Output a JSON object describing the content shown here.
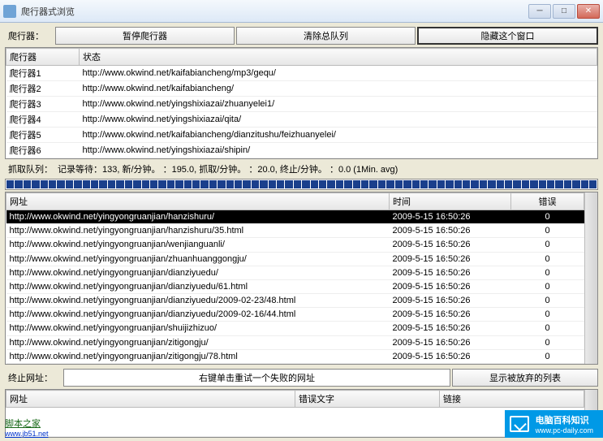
{
  "window": {
    "title": "爬行器式浏览"
  },
  "toolbar": {
    "label": "爬行器：",
    "pause": "暂停爬行器",
    "clearQueue": "清除总队列",
    "hide": "隐藏这个窗口"
  },
  "crawlerTable": {
    "headers": {
      "name": "爬行器",
      "status": "状态"
    },
    "rows": [
      {
        "name": "爬行器1",
        "status": "http://www.okwind.net/kaifabiancheng/mp3/gequ/"
      },
      {
        "name": "爬行器2",
        "status": "http://www.okwind.net/kaifabiancheng/"
      },
      {
        "name": "爬行器3",
        "status": "http://www.okwind.net/yingshixiazai/zhuanyelei1/"
      },
      {
        "name": "爬行器4",
        "status": "http://www.okwind.net/yingshixiazai/qita/"
      },
      {
        "name": "爬行器5",
        "status": "http://www.okwind.net/kaifabiancheng/dianzitushu/feizhuanyelei/"
      },
      {
        "name": "爬行器6",
        "status": "http://www.okwind.net/yingshixiazai/shipin/"
      }
    ]
  },
  "queue": {
    "label": "抓取队列：",
    "stats": "记录等待：133, 新/分钟。 ：195.0, 抓取/分钟。 ：20.0, 终止/分钟。 ：0.0 (1Min. avg)"
  },
  "urlTable": {
    "headers": {
      "url": "网址",
      "time": "时间",
      "err": "错误"
    },
    "rows": [
      {
        "url": "http://www.okwind.net/yingyongruanjian/hanzishuru/",
        "time": "2009-5-15 16:50:26",
        "err": "0",
        "sel": true
      },
      {
        "url": "http://www.okwind.net/yingyongruanjian/hanzishuru/35.html",
        "time": "2009-5-15 16:50:26",
        "err": "0"
      },
      {
        "url": "http://www.okwind.net/yingyongruanjian/wenjianguanli/",
        "time": "2009-5-15 16:50:26",
        "err": "0"
      },
      {
        "url": "http://www.okwind.net/yingyongruanjian/zhuanhuanggongju/",
        "time": "2009-5-15 16:50:26",
        "err": "0"
      },
      {
        "url": "http://www.okwind.net/yingyongruanjian/dianziyuedu/",
        "time": "2009-5-15 16:50:26",
        "err": "0"
      },
      {
        "url": "http://www.okwind.net/yingyongruanjian/dianziyuedu/61.html",
        "time": "2009-5-15 16:50:26",
        "err": "0"
      },
      {
        "url": "http://www.okwind.net/yingyongruanjian/dianziyuedu/2009-02-23/48.html",
        "time": "2009-5-15 16:50:26",
        "err": "0"
      },
      {
        "url": "http://www.okwind.net/yingyongruanjian/dianziyuedu/2009-02-16/44.html",
        "time": "2009-5-15 16:50:26",
        "err": "0"
      },
      {
        "url": "http://www.okwind.net/yingyongruanjian/shuijizhizuo/",
        "time": "2009-5-15 16:50:26",
        "err": "0"
      },
      {
        "url": "http://www.okwind.net/yingyongruanjian/zitigongju/",
        "time": "2009-5-15 16:50:26",
        "err": "0"
      },
      {
        "url": "http://www.okwind.net/yingyongruanjian/zitigongju/78.html",
        "time": "2009-5-15 16:50:26",
        "err": "0"
      }
    ]
  },
  "terminated": {
    "label": "终止网址：",
    "hint": "右键单击重试一个失败的网址",
    "showAbandoned": "显示被放弃的列表",
    "headers": {
      "url": "网址",
      "errText": "错误文字",
      "link": "链接"
    }
  },
  "footer": {
    "site1": "脚本之家",
    "site2": "www.jb51.net"
  },
  "badge": {
    "text": "电脑百科知识",
    "sub": "www.pc-daily.com"
  }
}
